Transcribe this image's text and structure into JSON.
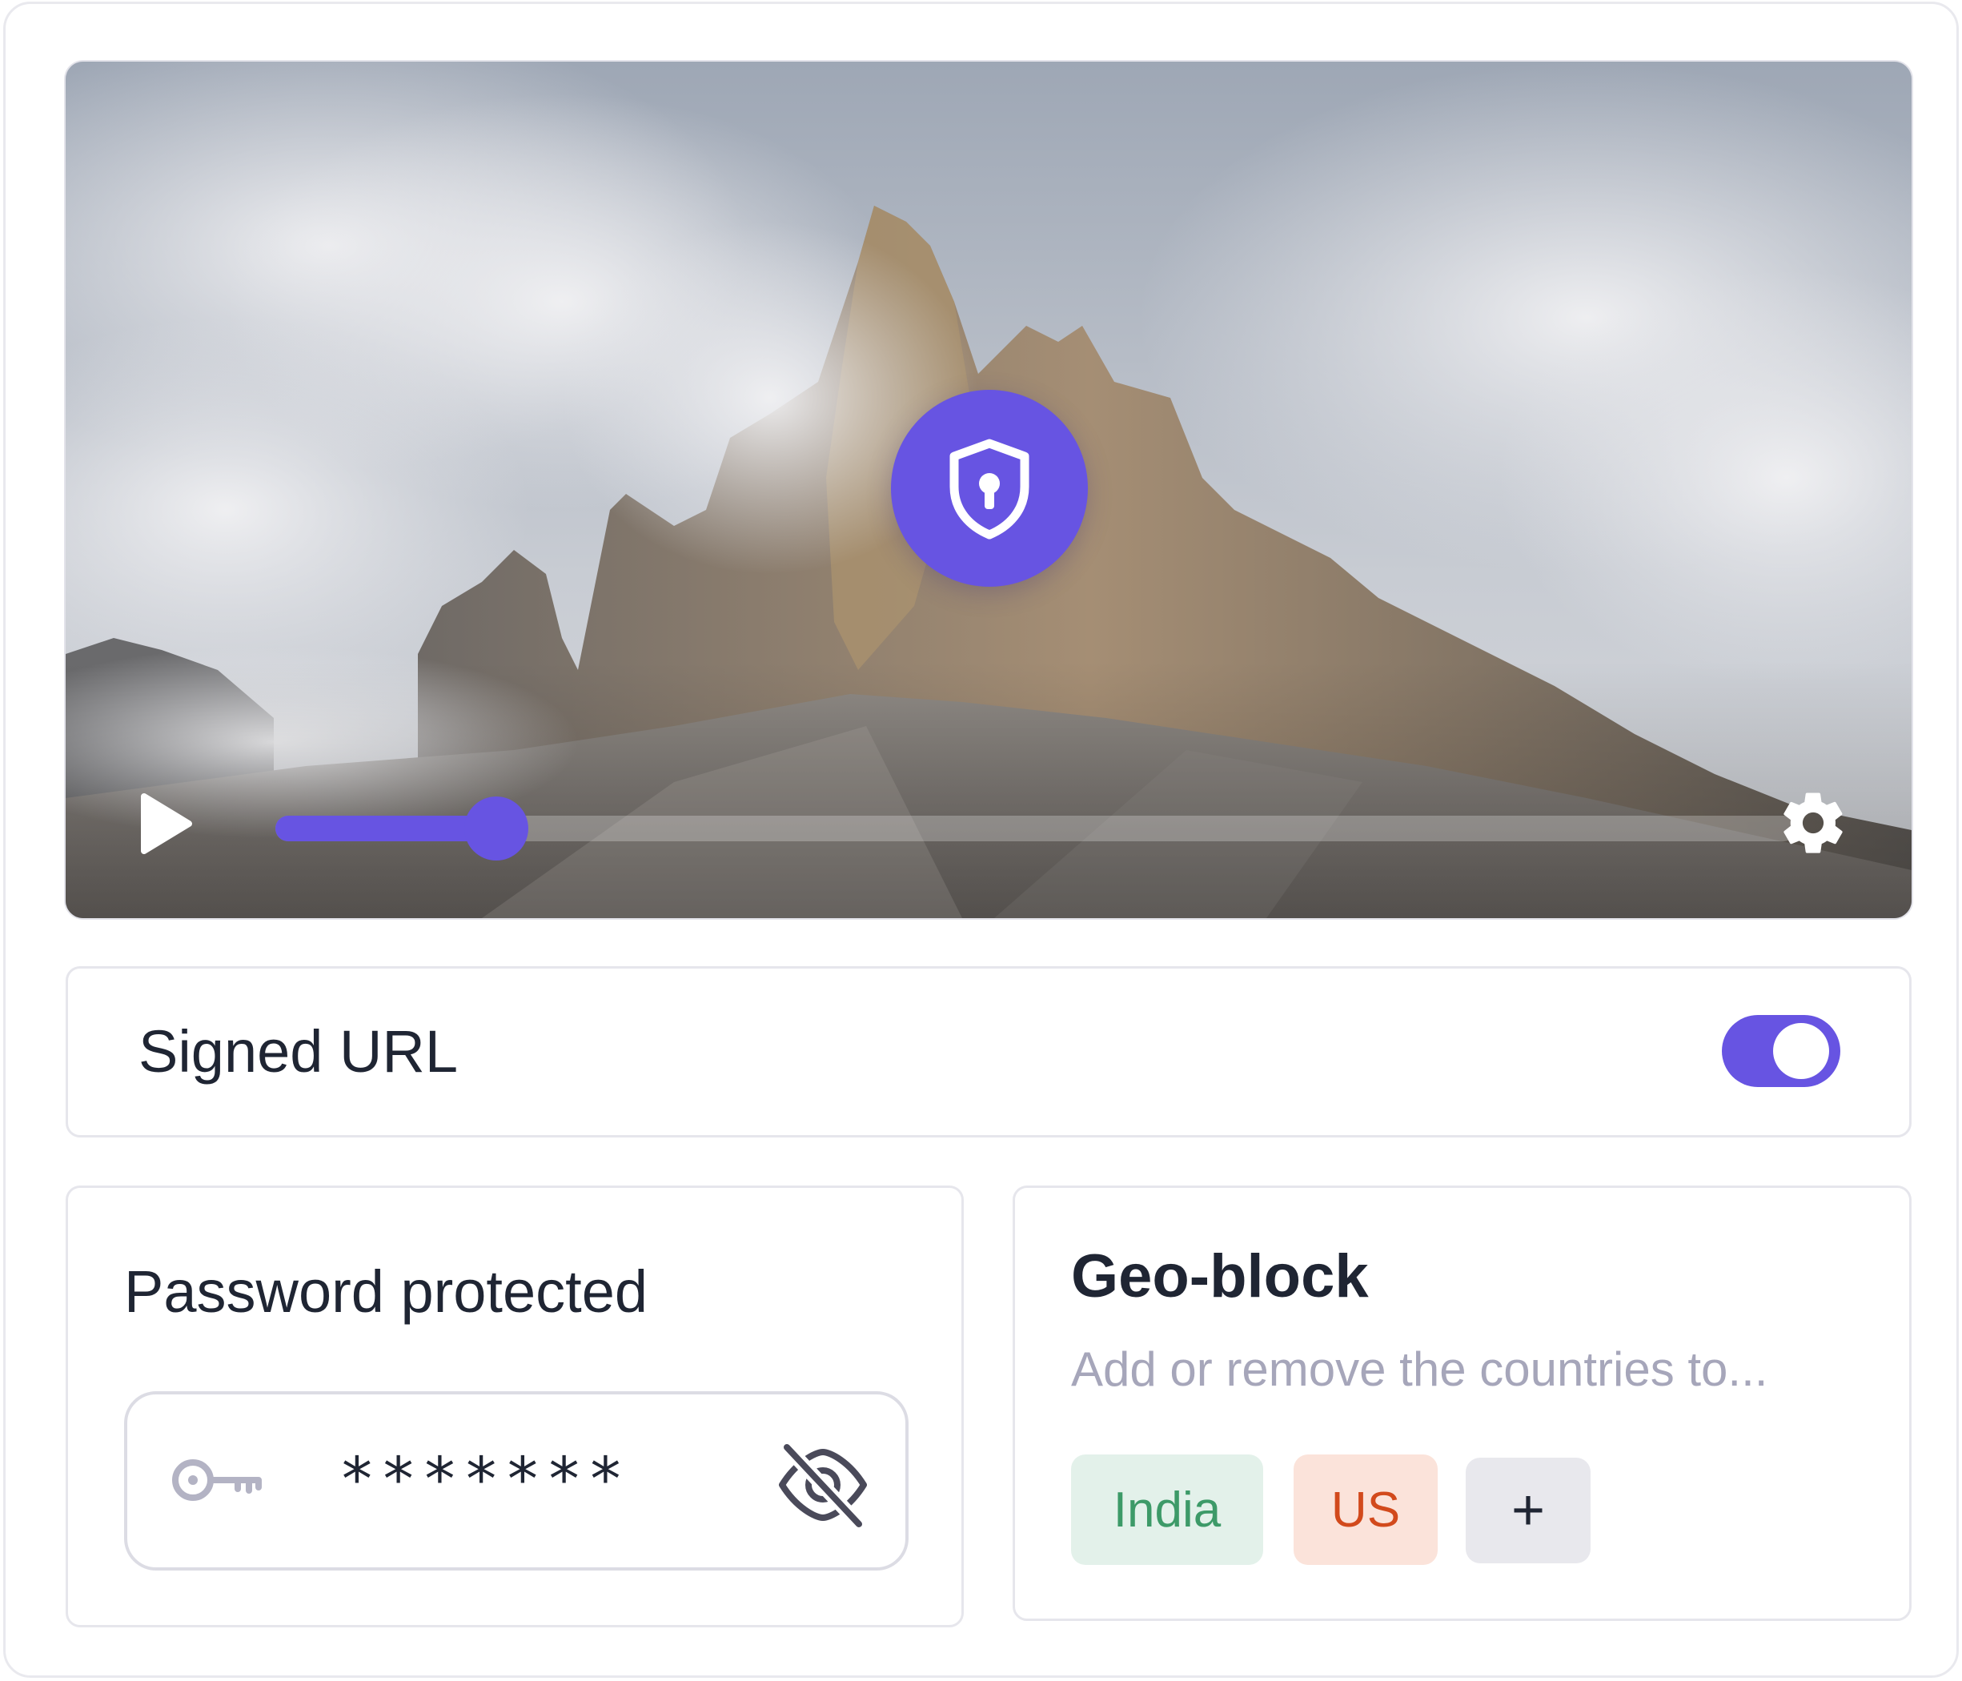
{
  "player": {
    "progress_percent": 14.5,
    "play_icon": "play-icon",
    "settings_icon": "gear-icon",
    "center_icon": "shield-keyhole-icon",
    "accent_color": "#6754e2"
  },
  "signed_url": {
    "label": "Signed URL",
    "toggle_on": true
  },
  "password": {
    "title": "Password protected",
    "value": "*******",
    "key_icon": "key-icon",
    "visibility_icon": "eye-off-icon"
  },
  "geo_block": {
    "title": "Geo-block",
    "description": "Add or remove the countries to...",
    "countries": [
      "India",
      "US"
    ],
    "add_label": "+",
    "colors": {
      "india_bg": "#e3f1ea",
      "india_text": "#3d9a68",
      "us_bg": "#fbe3da",
      "us_text": "#d24a1c"
    }
  }
}
